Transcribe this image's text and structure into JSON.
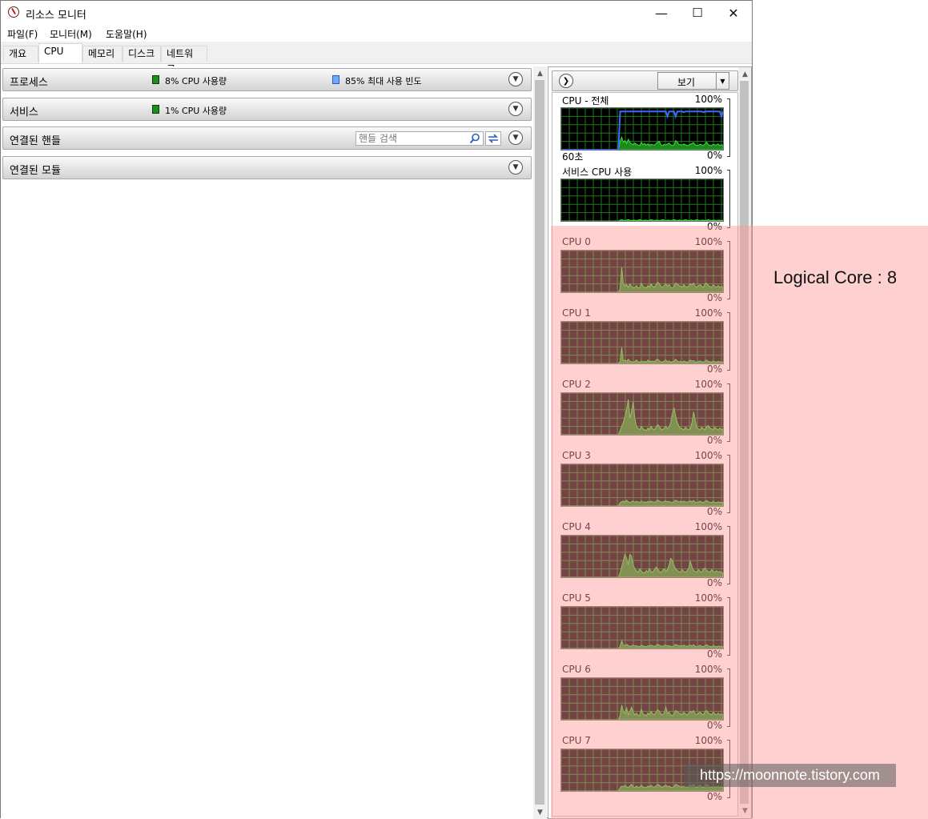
{
  "window": {
    "title": "리소스 모니터"
  },
  "window_controls": {
    "minimize": "—",
    "maximize": "☐",
    "close": "✕"
  },
  "menu": [
    "파일(F)",
    "모니터(M)",
    "도움말(H)"
  ],
  "tabs": [
    {
      "label": "개요",
      "active": false
    },
    {
      "label": "CPU",
      "active": true
    },
    {
      "label": "메모리",
      "active": false
    },
    {
      "label": "디스크",
      "active": false
    },
    {
      "label": "네트워크",
      "active": false
    }
  ],
  "sections": {
    "process": {
      "title": "프로세스",
      "cpu_usage": "8% CPU 사용량",
      "max_freq": "85% 최대 사용 빈도",
      "cpu_color": "#1e8c1e",
      "freq_color": "#6fa8ff"
    },
    "services": {
      "title": "서비스",
      "cpu_usage": "1% CPU 사용량",
      "cpu_color": "#1e8c1e"
    },
    "handles": {
      "title": "연결된 핸들",
      "search_placeholder": "핸들 검색"
    },
    "modules": {
      "title": "연결된 모듈"
    }
  },
  "right_panel": {
    "view_button": "보기"
  },
  "graphs": [
    {
      "title": "CPU - 전체",
      "max": "100%",
      "min": "0%",
      "time_label": "60초",
      "values": [
        0,
        0,
        0,
        0,
        0,
        0,
        0,
        0,
        0,
        0,
        0,
        0,
        0,
        0,
        0,
        0,
        0,
        0,
        0,
        0,
        0,
        0,
        0,
        0,
        0,
        0,
        0,
        0,
        0,
        0,
        0,
        0,
        0,
        0,
        0,
        0,
        20,
        30,
        18,
        22,
        15,
        25,
        18,
        14,
        12,
        16,
        13,
        11,
        10,
        18,
        12,
        15,
        11,
        14,
        10,
        13,
        12,
        11,
        15,
        18,
        20,
        12,
        10,
        13,
        11,
        14,
        16,
        12,
        10,
        11,
        22,
        18,
        13,
        12,
        11,
        14,
        12,
        10,
        11,
        13,
        15,
        17,
        12,
        10,
        11,
        13,
        12,
        10,
        14,
        18,
        12,
        11,
        10,
        13,
        12,
        11,
        14,
        10,
        12,
        11
      ],
      "freq": [
        0,
        0,
        0,
        0,
        0,
        0,
        0,
        0,
        0,
        0,
        0,
        0,
        0,
        0,
        0,
        0,
        0,
        0,
        0,
        0,
        0,
        0,
        0,
        0,
        0,
        0,
        0,
        0,
        0,
        0,
        0,
        0,
        0,
        0,
        0,
        0,
        92,
        92,
        92,
        92,
        92,
        92,
        92,
        92,
        92,
        92,
        92,
        92,
        92,
        92,
        92,
        92,
        92,
        92,
        92,
        92,
        92,
        92,
        92,
        92,
        92,
        92,
        92,
        92,
        92,
        80,
        92,
        92,
        92,
        92,
        80,
        92,
        92,
        92,
        92,
        90,
        92,
        92,
        92,
        92,
        92,
        92,
        92,
        92,
        92,
        92,
        92,
        90,
        92,
        92,
        92,
        92,
        92,
        92,
        92,
        92,
        92,
        92,
        80,
        92
      ]
    },
    {
      "title": "서비스 CPU 사용",
      "max": "100%",
      "min": "0%",
      "values": [
        0,
        0,
        0,
        0,
        0,
        0,
        0,
        0,
        0,
        0,
        0,
        0,
        0,
        0,
        0,
        0,
        0,
        0,
        0,
        0,
        0,
        0,
        0,
        0,
        0,
        0,
        0,
        0,
        0,
        0,
        0,
        0,
        0,
        0,
        0,
        0,
        2,
        3,
        2,
        1,
        2,
        3,
        2,
        1,
        2,
        2,
        1,
        2,
        3,
        2,
        1,
        2,
        2,
        1,
        2,
        3,
        2,
        1,
        2,
        2,
        1,
        2,
        3,
        2,
        1,
        2,
        2,
        1,
        2,
        3,
        2,
        1,
        2,
        2,
        1,
        2,
        3,
        2,
        1,
        2,
        2,
        1,
        2,
        3,
        2,
        1,
        2,
        2,
        1,
        2,
        3,
        2,
        1,
        2,
        2,
        1,
        2,
        2,
        1,
        2
      ]
    },
    {
      "title": "CPU 0",
      "max": "100%",
      "min": "0%",
      "values": [
        0,
        0,
        0,
        0,
        0,
        0,
        0,
        0,
        0,
        0,
        0,
        0,
        0,
        0,
        0,
        0,
        0,
        0,
        0,
        0,
        0,
        0,
        0,
        0,
        0,
        0,
        0,
        0,
        0,
        0,
        0,
        0,
        0,
        0,
        0,
        0,
        8,
        60,
        20,
        15,
        18,
        12,
        20,
        14,
        10,
        12,
        16,
        11,
        10,
        22,
        14,
        12,
        10,
        16,
        12,
        20,
        14,
        12,
        18,
        24,
        20,
        14,
        12,
        16,
        20,
        14,
        18,
        12,
        10,
        14,
        22,
        20,
        16,
        14,
        12,
        18,
        14,
        12,
        16,
        20,
        18,
        22,
        14,
        12,
        16,
        18,
        14,
        12,
        20,
        22,
        16,
        14,
        12,
        18,
        14,
        12,
        16,
        12,
        14,
        12
      ]
    },
    {
      "title": "CPU 1",
      "max": "100%",
      "min": "0%",
      "values": [
        0,
        0,
        0,
        0,
        0,
        0,
        0,
        0,
        0,
        0,
        0,
        0,
        0,
        0,
        0,
        0,
        0,
        0,
        0,
        0,
        0,
        0,
        0,
        0,
        0,
        0,
        0,
        0,
        0,
        0,
        0,
        0,
        0,
        0,
        0,
        0,
        4,
        38,
        6,
        8,
        5,
        10,
        6,
        4,
        3,
        5,
        8,
        4,
        3,
        6,
        4,
        5,
        3,
        8,
        4,
        6,
        5,
        4,
        8,
        10,
        6,
        4,
        3,
        6,
        8,
        4,
        6,
        3,
        4,
        5,
        10,
        6,
        4,
        5,
        3,
        6,
        4,
        3,
        5,
        8,
        6,
        7,
        4,
        3,
        5,
        6,
        4,
        3,
        6,
        8,
        5,
        4,
        3,
        6,
        4,
        3,
        5,
        4,
        3,
        4
      ]
    },
    {
      "title": "CPU 2",
      "max": "100%",
      "min": "0%",
      "values": [
        0,
        0,
        0,
        0,
        0,
        0,
        0,
        0,
        0,
        0,
        0,
        0,
        0,
        0,
        0,
        0,
        0,
        0,
        0,
        0,
        0,
        0,
        0,
        0,
        0,
        0,
        0,
        0,
        0,
        0,
        0,
        0,
        0,
        0,
        0,
        0,
        10,
        20,
        30,
        45,
        60,
        85,
        40,
        55,
        80,
        40,
        20,
        15,
        12,
        20,
        14,
        12,
        10,
        16,
        12,
        20,
        14,
        12,
        18,
        24,
        20,
        14,
        12,
        16,
        20,
        14,
        18,
        30,
        50,
        65,
        45,
        30,
        20,
        16,
        14,
        12,
        18,
        14,
        12,
        16,
        30,
        55,
        35,
        16,
        14,
        12,
        18,
        14,
        12,
        20,
        22,
        16,
        14,
        12,
        18,
        14,
        12,
        16,
        12,
        14
      ]
    },
    {
      "title": "CPU 3",
      "max": "100%",
      "min": "0%",
      "values": [
        0,
        0,
        0,
        0,
        0,
        0,
        0,
        0,
        0,
        0,
        0,
        0,
        0,
        0,
        0,
        0,
        0,
        0,
        0,
        0,
        0,
        0,
        0,
        0,
        0,
        0,
        0,
        0,
        0,
        0,
        0,
        0,
        0,
        0,
        0,
        0,
        8,
        10,
        12,
        9,
        14,
        10,
        8,
        10,
        12,
        9,
        11,
        10,
        8,
        12,
        9,
        10,
        8,
        11,
        9,
        12,
        10,
        9,
        11,
        14,
        12,
        10,
        9,
        11,
        12,
        10,
        11,
        9,
        8,
        10,
        14,
        12,
        10,
        11,
        9,
        12,
        10,
        9,
        11,
        12,
        10,
        13,
        9,
        8,
        10,
        12,
        9,
        8,
        11,
        13,
        10,
        9,
        8,
        11,
        9,
        8,
        10,
        9,
        8,
        9
      ]
    },
    {
      "title": "CPU 4",
      "max": "100%",
      "min": "0%",
      "values": [
        0,
        0,
        0,
        0,
        0,
        0,
        0,
        0,
        0,
        0,
        0,
        0,
        0,
        0,
        0,
        0,
        0,
        0,
        0,
        0,
        0,
        0,
        0,
        0,
        0,
        0,
        0,
        0,
        0,
        0,
        0,
        0,
        0,
        0,
        0,
        0,
        10,
        25,
        40,
        55,
        45,
        30,
        55,
        50,
        30,
        20,
        15,
        12,
        20,
        14,
        12,
        10,
        16,
        12,
        20,
        14,
        12,
        18,
        24,
        20,
        14,
        12,
        16,
        20,
        14,
        18,
        30,
        45,
        40,
        28,
        20,
        16,
        14,
        12,
        18,
        14,
        12,
        16,
        22,
        38,
        25,
        16,
        14,
        12,
        18,
        14,
        12,
        20,
        22,
        16,
        14,
        12,
        18,
        14,
        12,
        16,
        12,
        14,
        12,
        10
      ]
    },
    {
      "title": "CPU 5",
      "max": "100%",
      "min": "0%",
      "values": [
        0,
        0,
        0,
        0,
        0,
        0,
        0,
        0,
        0,
        0,
        0,
        0,
        0,
        0,
        0,
        0,
        0,
        0,
        0,
        0,
        0,
        0,
        0,
        0,
        0,
        0,
        0,
        0,
        0,
        0,
        0,
        0,
        0,
        0,
        0,
        0,
        5,
        18,
        8,
        6,
        10,
        7,
        5,
        6,
        8,
        6,
        7,
        5,
        4,
        8,
        6,
        5,
        4,
        7,
        5,
        8,
        6,
        5,
        7,
        10,
        8,
        6,
        5,
        7,
        8,
        6,
        7,
        5,
        4,
        6,
        10,
        8,
        6,
        7,
        5,
        8,
        6,
        5,
        7,
        8,
        6,
        9,
        5,
        4,
        6,
        8,
        5,
        4,
        7,
        9,
        6,
        5,
        4,
        7,
        5,
        4,
        6,
        5,
        4,
        5
      ]
    },
    {
      "title": "CPU 6",
      "max": "100%",
      "min": "0%",
      "values": [
        0,
        0,
        0,
        0,
        0,
        0,
        0,
        0,
        0,
        0,
        0,
        0,
        0,
        0,
        0,
        0,
        0,
        0,
        0,
        0,
        0,
        0,
        0,
        0,
        0,
        0,
        0,
        0,
        0,
        0,
        0,
        0,
        0,
        0,
        0,
        0,
        10,
        35,
        20,
        15,
        28,
        12,
        20,
        30,
        18,
        12,
        16,
        11,
        10,
        25,
        14,
        12,
        10,
        16,
        12,
        20,
        14,
        12,
        18,
        24,
        20,
        14,
        12,
        16,
        30,
        14,
        18,
        12,
        10,
        14,
        22,
        20,
        16,
        14,
        12,
        18,
        14,
        12,
        16,
        20,
        18,
        22,
        14,
        12,
        16,
        18,
        14,
        12,
        20,
        22,
        16,
        14,
        12,
        18,
        14,
        12,
        16,
        12,
        14,
        12
      ]
    },
    {
      "title": "CPU 7",
      "max": "100%",
      "min": "0%",
      "values": [
        0,
        0,
        0,
        0,
        0,
        0,
        0,
        0,
        0,
        0,
        0,
        0,
        0,
        0,
        0,
        0,
        0,
        0,
        0,
        0,
        0,
        0,
        0,
        0,
        0,
        0,
        0,
        0,
        0,
        0,
        0,
        0,
        0,
        0,
        0,
        0,
        8,
        12,
        10,
        14,
        10,
        8,
        12,
        16,
        10,
        8,
        12,
        9,
        8,
        14,
        10,
        9,
        8,
        12,
        9,
        14,
        10,
        9,
        12,
        16,
        14,
        10,
        9,
        12,
        14,
        10,
        12,
        9,
        8,
        10,
        16,
        14,
        12,
        10,
        9,
        12,
        10,
        9,
        12,
        14,
        12,
        16,
        10,
        9,
        12,
        14,
        10,
        9,
        14,
        16,
        12,
        10,
        9,
        12,
        10,
        9,
        12,
        10,
        9,
        10
      ]
    }
  ],
  "colors": {
    "graph_bg": "#000000",
    "grid": "#1f7a1f",
    "line": "#40e040",
    "fill": "#1d8a1d",
    "freq_line": "#3a6bff"
  },
  "annotation": "Logical Core : 8",
  "watermark": "https://moonnote.tistory.com"
}
